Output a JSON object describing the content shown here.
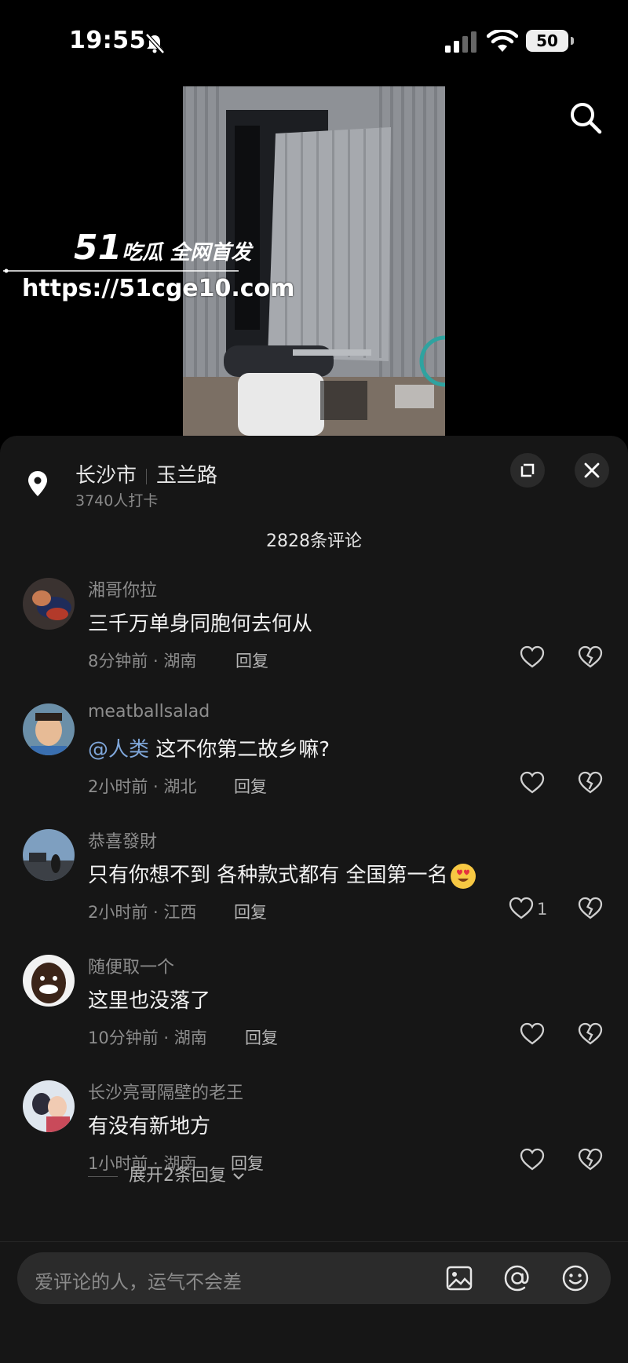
{
  "status_bar": {
    "time": "19:55",
    "battery": "50"
  },
  "watermark": {
    "brand_number": "51",
    "brand_text": "吃瓜 全网首发",
    "url": "https://51cge10.com"
  },
  "location": {
    "city": "长沙市",
    "road": "玉兰路",
    "checkins": "3740人打卡"
  },
  "comment_count": "2828条评论",
  "comments": [
    {
      "user": "湘哥你拉",
      "text": "三千万单身同胞何去何从",
      "time_region": "8分钟前 · 湖南",
      "reply": "回复",
      "likes": ""
    },
    {
      "user": "meatballsalad",
      "mention": "@人类",
      "text": " 这不你第二故乡嘛?",
      "time_region": "2小时前 · 湖北",
      "reply": "回复",
      "likes": ""
    },
    {
      "user": "恭喜發財",
      "text": "只有你想不到 各种款式都有 全国第一名",
      "time_region": "2小时前 · 江西",
      "reply": "回复",
      "likes": "1"
    },
    {
      "user": "随便取一个",
      "text": "这里也没落了",
      "time_region": "10分钟前 · 湖南",
      "reply": "回复",
      "likes": ""
    },
    {
      "user": "长沙亮哥隔壁的老王",
      "text": "有没有新地方",
      "time_region": "1小时前 · 湖南",
      "reply": "回复",
      "likes": ""
    }
  ],
  "expand_replies": "展开2条回复",
  "input": {
    "placeholder": "爱评论的人，运气不会差"
  },
  "icons": [
    "bell-off-icon",
    "signal-icon",
    "wifi-icon",
    "battery-icon",
    "search-icon",
    "location-pin-icon",
    "expand-icon",
    "close-icon",
    "heart-icon",
    "broken-heart-icon",
    "image-icon",
    "at-icon",
    "emoji-icon",
    "heart-eyes-emoji"
  ],
  "colors": {
    "sheet_bg": "#161616",
    "mention": "#7fa6d9",
    "muted": "#8d8d8d"
  }
}
